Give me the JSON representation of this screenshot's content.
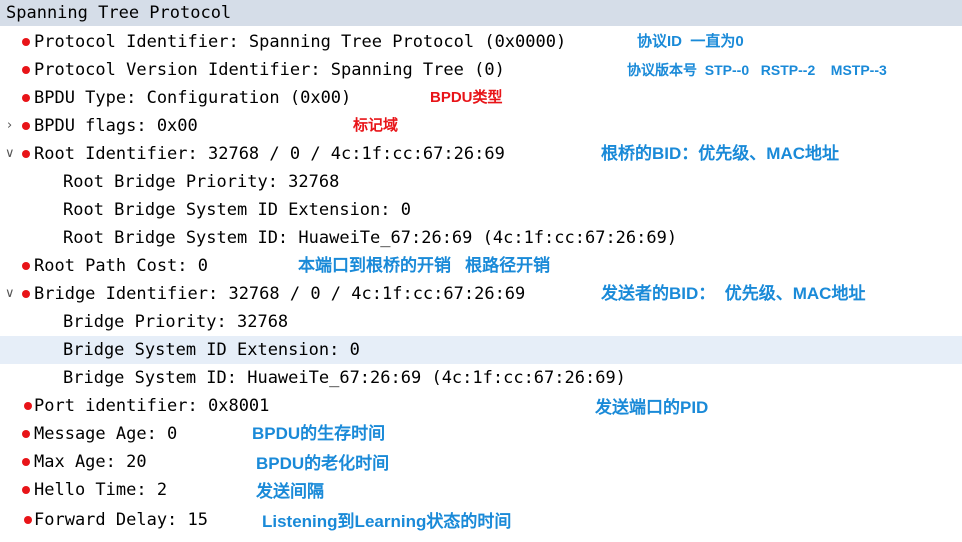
{
  "colors": {
    "header_bg": "#d5dde8",
    "highlight_bg": "#e6eef8",
    "bullet": "#e81418",
    "note_blue": "#1a8ad8",
    "note_red": "#e81418"
  },
  "tree": {
    "header": "Spanning Tree Protocol",
    "protocol_identifier": "Protocol Identifier: Spanning Tree Protocol (0x0000)",
    "protocol_version": "Protocol Version Identifier: Spanning Tree (0)",
    "bpdu_type": "BPDU Type: Configuration (0x00)",
    "bpdu_flags": "BPDU flags: 0x00",
    "root_identifier": "Root Identifier: 32768 / 0 / 4c:1f:cc:67:26:69",
    "root_bridge_priority": "Root Bridge Priority: 32768",
    "root_bridge_sysid_ext": "Root Bridge System ID Extension: 0",
    "root_bridge_sysid": "Root Bridge System ID: HuaweiTe_67:26:69 (4c:1f:cc:67:26:69)",
    "root_path_cost": "Root Path Cost: 0",
    "bridge_identifier": "Bridge Identifier: 32768 / 0 / 4c:1f:cc:67:26:69",
    "bridge_priority": "Bridge Priority: 32768",
    "bridge_sysid_ext": "Bridge System ID Extension: 0",
    "bridge_sysid": "Bridge System ID: HuaweiTe_67:26:69 (4c:1f:cc:67:26:69)",
    "port_identifier": "Port identifier: 0x8001",
    "message_age": "Message Age: 0",
    "max_age": "Max Age: 20",
    "hello_time": "Hello Time: 2",
    "forward_delay": "Forward Delay: 15"
  },
  "annotations": {
    "protocol_id": "协议ID  一直为0",
    "protocol_version": "协议版本号  STP--0   RSTP--2    MSTP--3",
    "bpdu_type": "BPDU类型",
    "bpdu_flags": "标记域",
    "root_bid": "根桥的BID：优先级、MAC地址",
    "root_path_cost": "本端口到根桥的开销   根路径开销",
    "sender_bid": "发送者的BID：  优先级、MAC地址",
    "port_pid": "发送端口的PID",
    "message_age": "BPDU的生存时间",
    "max_age": "BPDU的老化时间",
    "hello_time": "发送间隔",
    "forward_delay": "Listening到Learning状态的时间"
  },
  "icons": {
    "collapsed": "chevron-right-icon",
    "expanded": "chevron-down-icon",
    "bullet": "red-dot-icon"
  }
}
